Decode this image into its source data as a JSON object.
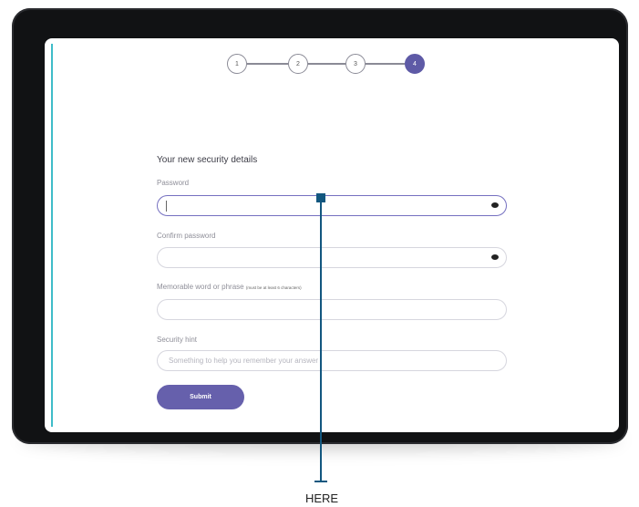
{
  "stepper": {
    "steps": [
      "1",
      "2",
      "3",
      "4"
    ],
    "current": 4,
    "accent_color": "#5e5aa6"
  },
  "form": {
    "title": "Your new security details",
    "password": {
      "label": "Password",
      "value": "",
      "icon": "eye-icon"
    },
    "confirm": {
      "label": "Confirm password",
      "value": "",
      "icon": "eye-icon"
    },
    "memorable": {
      "label": "Memorable word or phrase",
      "hint": "(must be at least 6 characters)",
      "value": ""
    },
    "security_hint": {
      "label": "Security hint",
      "placeholder": "Something to help you remember your answer"
    },
    "submit_label": "Submit"
  },
  "annotation": {
    "label": "HERE",
    "color": "#12577f"
  }
}
